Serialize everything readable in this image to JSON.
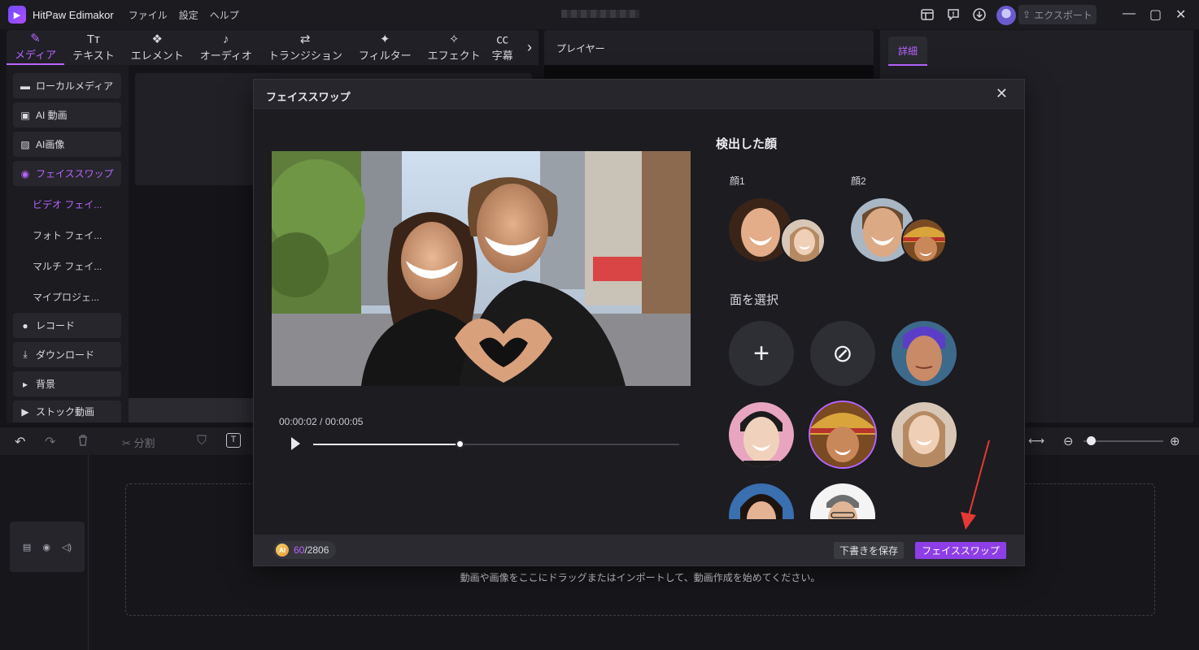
{
  "app": {
    "title": "HitPaw Edimakor",
    "logo_glyph": "▶",
    "menu": [
      "ファイル",
      "設定",
      "ヘルプ"
    ],
    "export_label": "エクスポート",
    "window_controls": [
      "—",
      "▢",
      "✕"
    ]
  },
  "tool_tabs": [
    {
      "label": "メディア",
      "icon": "media-icon",
      "glyph": "✎",
      "active": true
    },
    {
      "label": "テキスト",
      "icon": "text-icon",
      "glyph": "Tт",
      "active": false
    },
    {
      "label": "エレメント",
      "icon": "element-icon",
      "glyph": "❖",
      "active": false
    },
    {
      "label": "オーディオ",
      "icon": "audio-icon",
      "glyph": "♪",
      "active": false
    },
    {
      "label": "トランジション",
      "icon": "transition-icon",
      "glyph": "⇄",
      "active": false
    },
    {
      "label": "フィルター",
      "icon": "filter-icon",
      "glyph": "✦",
      "active": false
    },
    {
      "label": "エフェクト",
      "icon": "effect-icon",
      "glyph": "✧",
      "active": false
    },
    {
      "label": "字幕",
      "icon": "caption-icon",
      "glyph": "㏄",
      "active": false
    }
  ],
  "tool_tabs_arrow": "›",
  "sidebar": {
    "items": [
      {
        "label": "ローカルメディア",
        "icon": "folder-icon",
        "glyph": "▬"
      },
      {
        "label": "AI 動画",
        "icon": "ai-video-icon",
        "glyph": "▣"
      },
      {
        "label": "AI画像",
        "icon": "ai-image-icon",
        "glyph": "▨"
      },
      {
        "label": "フェイススワップ",
        "icon": "face-swap-icon",
        "glyph": "◉",
        "active": true
      }
    ],
    "sub_items": [
      {
        "label": "ビデオ フェイ...",
        "active": true
      },
      {
        "label": "フォト フェイ...",
        "active": false
      },
      {
        "label": "マルチ フェイ...",
        "active": false
      },
      {
        "label": "マイプロジェ...",
        "active": false
      }
    ],
    "items2": [
      {
        "label": "レコード",
        "icon": "record-icon",
        "glyph": "●"
      },
      {
        "label": "ダウンロード",
        "icon": "download-icon",
        "glyph": "⤓"
      },
      {
        "label": "背景",
        "icon": "background-icon",
        "glyph": "▸"
      },
      {
        "label": "ストック動画",
        "icon": "stock-video-icon",
        "glyph": "▶"
      }
    ]
  },
  "player": {
    "title": "プレイヤー"
  },
  "details": {
    "tab_label": "詳細"
  },
  "timeline": {
    "split_label": "分割",
    "drop_text": "動画や画像をここにドラッグまたはインポートして、動画作成を始めてください。"
  },
  "dialog": {
    "title": "フェイススワップ",
    "current_time": "00:00:02",
    "total_time": "00:00:05",
    "time_separator": " / ",
    "progress_fraction": 0.4,
    "detected_title": "検出した顔",
    "faces": [
      {
        "label": "顔1"
      },
      {
        "label": "顔2"
      }
    ],
    "select_title": "面を選択",
    "add_glyph": "+",
    "none_glyph": "⊘",
    "credits_used": "60",
    "credits_total": "/2806",
    "ai_badge": "AI",
    "save_draft_label": "下書きを保存",
    "swap_label": "フェイススワップ",
    "close_glyph": "✕"
  },
  "colors": {
    "accent": "#b865ff",
    "primary_button": "#8e3ee6",
    "annotation_arrow": "#e53935"
  }
}
